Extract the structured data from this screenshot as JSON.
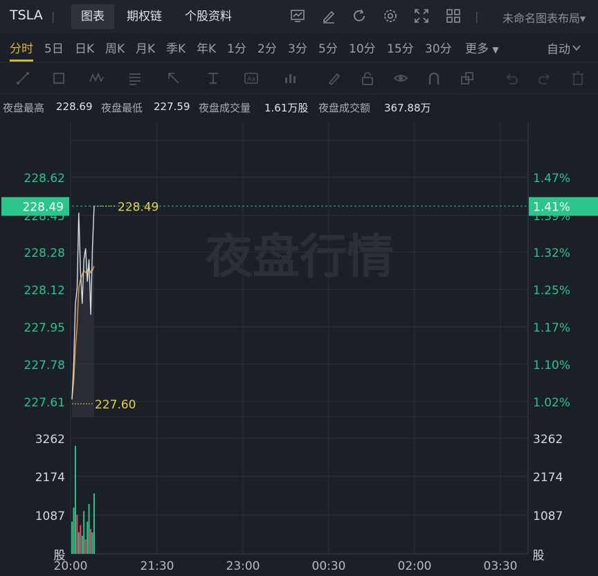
{
  "topbar": {
    "symbol": "TSLA",
    "tabs": [
      "图表",
      "期权链",
      "个股资料"
    ],
    "layout_label": "未命名图表布局"
  },
  "periods": [
    "分时",
    "5日",
    "日K",
    "周K",
    "月K",
    "季K",
    "年K",
    "1分",
    "2分",
    "3分",
    "5分",
    "10分",
    "15分",
    "30分",
    "更多"
  ],
  "auto_label": "自动",
  "stats": {
    "high_label": "夜盘最高",
    "high": "228.69",
    "low_label": "夜盘最低",
    "low": "227.59",
    "vol_label": "夜盘成交量",
    "vol": "1.61万股",
    "amt_label": "夜盘成交额",
    "amt": "367.88万"
  },
  "colors": {
    "up": "#2bc48a",
    "down": "#f2495c",
    "price_line": "#d9dce1",
    "avg_line": "#e59a3a",
    "marker": "#e8d33a"
  },
  "chart_data": {
    "type": "line",
    "watermark": "夜盘行情",
    "price_axis_left": [
      "228.62",
      "228.45",
      "228.28",
      "228.12",
      "227.95",
      "227.78",
      "227.61"
    ],
    "pct_axis_right": [
      "1.47%",
      "1.39%",
      "1.32%",
      "1.25%",
      "1.17%",
      "1.10%",
      "1.02%"
    ],
    "volume_axis": [
      "3262",
      "2174",
      "1087"
    ],
    "volume_unit": "股",
    "x_ticks": [
      "20:00",
      "21:30",
      "23:00",
      "00:30",
      "02:00",
      "03:30"
    ],
    "current_price": "228.49",
    "current_pct": "1.41%",
    "high_marker": "228.49",
    "low_marker": "227.60",
    "ylim": [
      227.61,
      228.62
    ],
    "series": [
      {
        "values": [
          227.62,
          227.78,
          228.05,
          228.12,
          228.46,
          228.2,
          228.05,
          228.25,
          228.3,
          228.15,
          228.25,
          228.0,
          228.3,
          228.49
        ]
      },
      {
        "values": [
          227.62,
          227.7,
          227.85,
          227.95,
          228.12,
          228.16,
          228.18,
          228.2,
          228.19,
          228.2,
          228.21,
          228.19,
          228.2,
          228.22
        ]
      }
    ],
    "volume": [
      900,
      1300,
      3050,
      1100,
      600,
      800,
      500,
      1200,
      400,
      900,
      1400,
      700,
      600,
      1700
    ],
    "volume_up": [
      true,
      true,
      true,
      false,
      true,
      false,
      true,
      true,
      false,
      true,
      true,
      false,
      true,
      true
    ]
  }
}
